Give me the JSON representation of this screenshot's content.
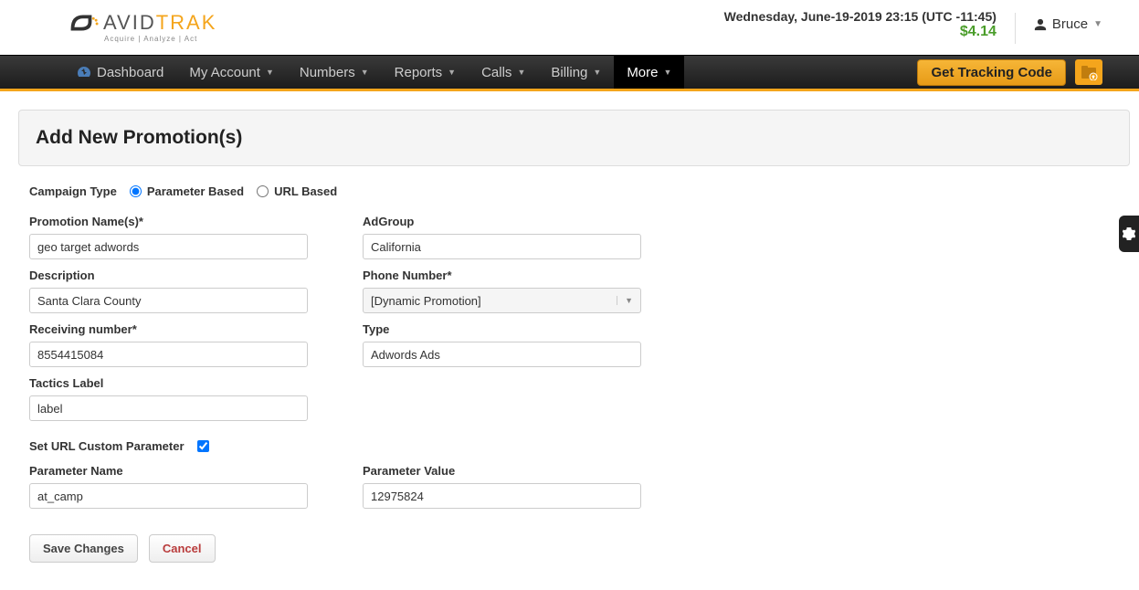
{
  "header": {
    "logo_text_1": "AVID",
    "logo_text_2": "TRAK",
    "logo_sub": "Acquire | Analyze | Act",
    "datetime": "Wednesday, June-19-2019 23:15 (UTC -11:45)",
    "balance": "$4.14",
    "user_name": "Bruce"
  },
  "nav": {
    "dashboard": "Dashboard",
    "my_account": "My Account",
    "numbers": "Numbers",
    "reports": "Reports",
    "calls": "Calls",
    "billing": "Billing",
    "more": "More",
    "tracking_code": "Get Tracking Code"
  },
  "page": {
    "title": "Add New Promotion(s)",
    "campaign_type_label": "Campaign Type",
    "radio_parameter": "Parameter Based",
    "radio_url": "URL Based",
    "promotion_name_label": "Promotion Name(s)*",
    "promotion_name_value": "geo target adwords",
    "description_label": "Description",
    "description_value": "Santa Clara County",
    "receiving_number_label": "Receiving number*",
    "receiving_number_value": "8554415084",
    "tactics_label_label": "Tactics Label",
    "tactics_label_value": "label",
    "adgroup_label": "AdGroup",
    "adgroup_value": "California",
    "phone_number_label": "Phone Number*",
    "phone_number_value": "[Dynamic Promotion]",
    "type_label": "Type",
    "type_value": "Adwords Ads",
    "set_custom_param_label": "Set URL Custom Parameter",
    "parameter_name_label": "Parameter Name",
    "parameter_name_value": "at_camp",
    "parameter_value_label": "Parameter Value",
    "parameter_value_value": "12975824",
    "save_btn": "Save Changes",
    "cancel_btn": "Cancel"
  }
}
